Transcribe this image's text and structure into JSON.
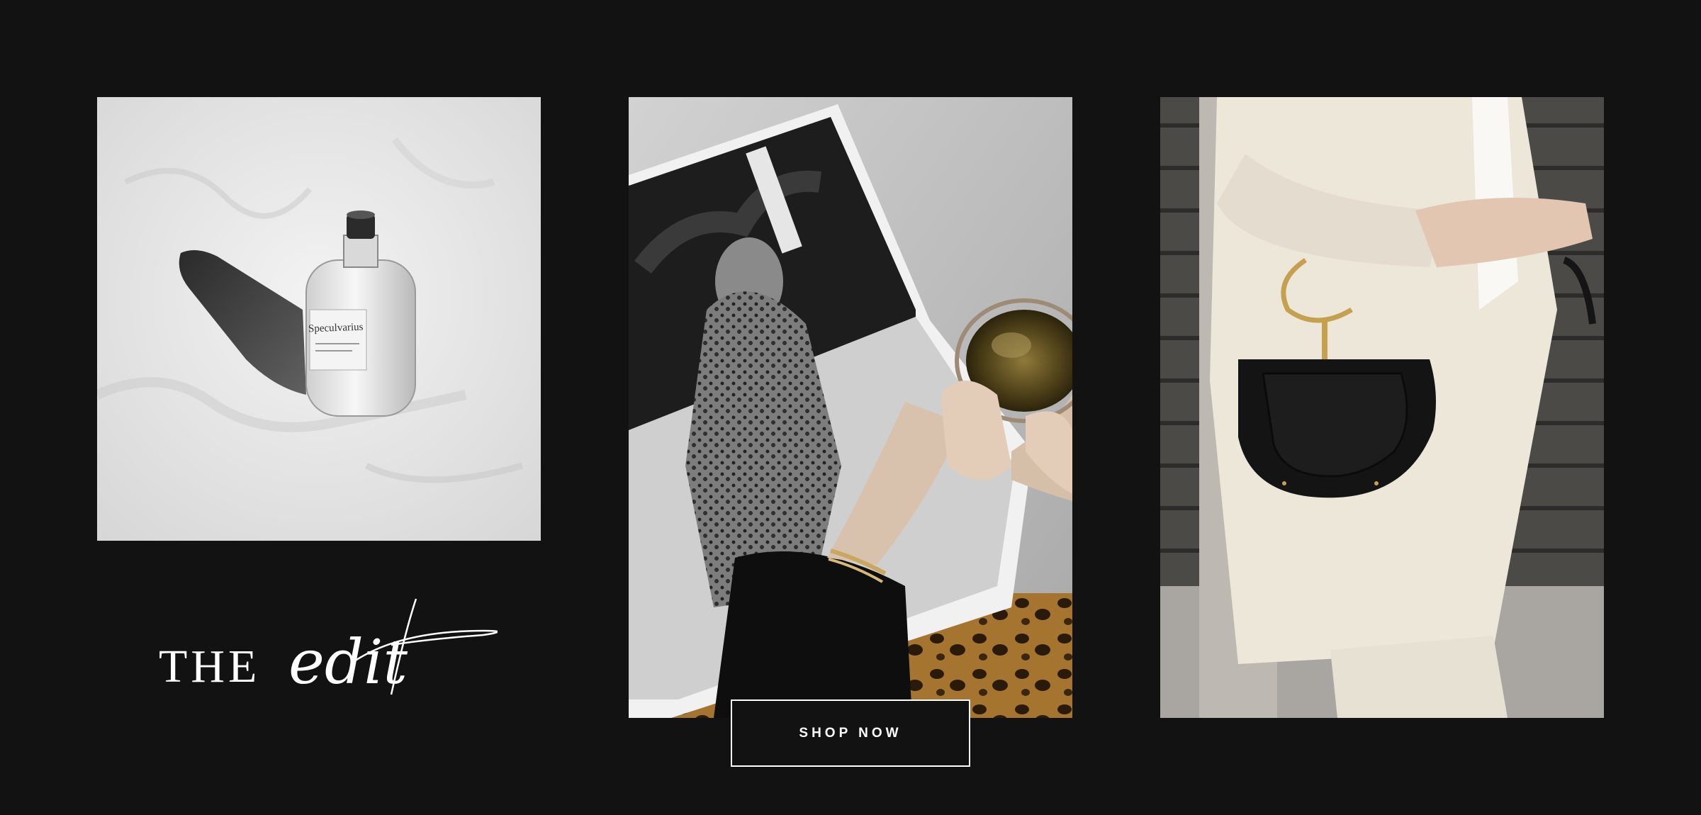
{
  "brand": {
    "logo_the": "THE",
    "logo_edit": "edit"
  },
  "bottle_label": "Speculvarius",
  "cta": {
    "shop_now": "SHOP NOW"
  },
  "colors": {
    "background": "#121212",
    "text": "#ffffff",
    "button_border": "#ffffff"
  }
}
